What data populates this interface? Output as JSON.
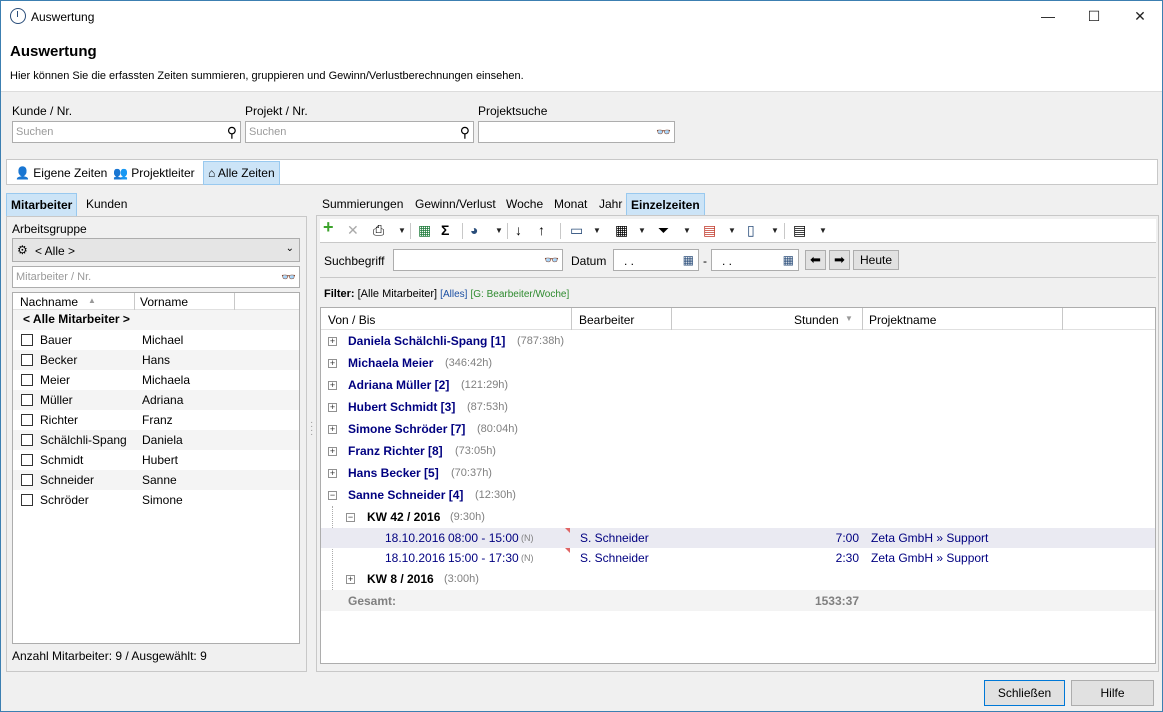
{
  "window": {
    "title": "Auswertung",
    "minimize": "—",
    "maximize": "☐",
    "close": "✕"
  },
  "header": {
    "title": "Auswertung",
    "subtitle": "Hier können Sie die erfassten Zeiten summieren, gruppieren und Gewinn/Verlustberechnungen einsehen."
  },
  "search": {
    "kunde_label": "Kunde / Nr.",
    "kunde_placeholder": "Suchen",
    "projekt_label": "Projekt / Nr.",
    "projekt_placeholder": "Suchen",
    "projektsuche_label": "Projektsuche"
  },
  "scope_tabs": [
    "Eigene Zeiten",
    "Projektleiter",
    "Alle Zeiten"
  ],
  "left_tabs": [
    "Mitarbeiter",
    "Kunden"
  ],
  "left": {
    "group_label": "Arbeitsgruppe",
    "group_value": "< Alle >",
    "employee_placeholder": "Mitarbeiter / Nr.",
    "col_lastname": "Nachname",
    "col_firstname": "Vorname",
    "all_label": "< Alle Mitarbeiter >",
    "employees": [
      {
        "last": "Bauer",
        "first": "Michael"
      },
      {
        "last": "Becker",
        "first": "Hans"
      },
      {
        "last": "Meier",
        "first": "Michaela"
      },
      {
        "last": "Müller",
        "first": "Adriana"
      },
      {
        "last": "Richter",
        "first": "Franz"
      },
      {
        "last": "Schälchli-Spang",
        "first": "Daniela"
      },
      {
        "last": "Schmidt",
        "first": "Hubert"
      },
      {
        "last": "Schneider",
        "first": "Sanne"
      },
      {
        "last": "Schröder",
        "first": "Simone"
      }
    ],
    "footer": "Anzahl Mitarbeiter: 9 / Ausgewählt: 9"
  },
  "right_tabs": [
    "Summierungen",
    "Gewinn/Verlust",
    "Woche",
    "Monat",
    "Jahr",
    "Einzelzeiten"
  ],
  "filterbar": {
    "search_label": "Suchbegriff",
    "date_label": "Datum",
    "date_from": " .  .",
    "date_to": " .  .",
    "dash": "-",
    "today_button": "Heute"
  },
  "filter": {
    "label": "Filter:",
    "main": "[Alle Mitarbeiter]",
    "all": "[Alles]",
    "group": "[G: Bearbeiter/Woche]"
  },
  "grid": {
    "columns": [
      "Von / Bis",
      "Bearbeiter",
      "Stunden",
      "Projektname"
    ],
    "groups": [
      {
        "name": "Daniela Schälchli-Spang [1]",
        "hours": "(787:38h)"
      },
      {
        "name": "Michaela Meier",
        "hours": "(346:42h)"
      },
      {
        "name": "Adriana Müller [2]",
        "hours": "(121:29h)"
      },
      {
        "name": "Hubert Schmidt [3]",
        "hours": "(87:53h)"
      },
      {
        "name": "Simone Schröder [7]",
        "hours": "(80:04h)"
      },
      {
        "name": "Franz Richter [8]",
        "hours": "(73:05h)"
      },
      {
        "name": "Hans Becker [5]",
        "hours": "(70:37h)"
      },
      {
        "name": "Sanne Schneider [4]",
        "hours": "(12:30h)"
      }
    ],
    "week1": {
      "name": "KW 42 / 2016",
      "hours": "(9:30h)"
    },
    "entries": [
      {
        "date": "18.10.2016",
        "time": "08:00 - 15:00",
        "flag": "(N)",
        "user": "S. Schneider",
        "hours": "7:00",
        "project": "Zeta GmbH » Support"
      },
      {
        "date": "18.10.2016",
        "time": "15:00 - 17:30",
        "flag": "(N)",
        "user": "S. Schneider",
        "hours": "2:30",
        "project": "Zeta GmbH » Support"
      }
    ],
    "week2": {
      "name": "KW 8 / 2016",
      "hours": "(3:00h)"
    },
    "total_label": "Gesamt:",
    "total_value": "1533:37"
  },
  "buttons": {
    "close": "Schließen",
    "help": "Hilfe"
  }
}
